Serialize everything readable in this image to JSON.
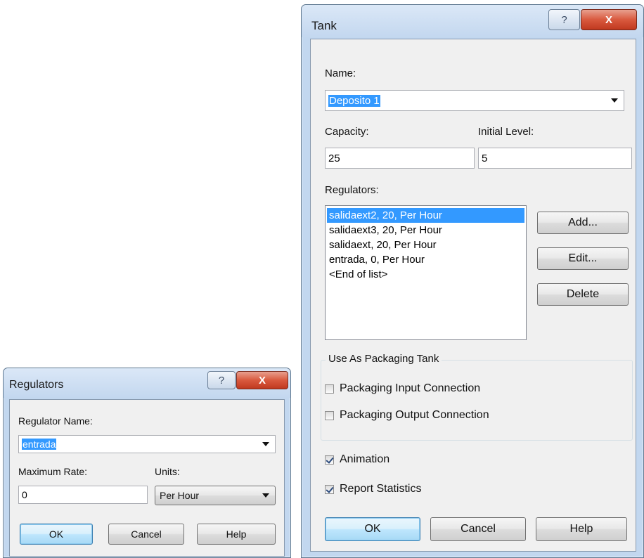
{
  "tank_dialog": {
    "title": "Tank",
    "help_glyph": "?",
    "close_glyph": "X",
    "name_label": "Name:",
    "name_value": "Deposito 1",
    "capacity_label": "Capacity:",
    "capacity_value": "25",
    "initial_level_label": "Initial Level:",
    "initial_level_value": "5",
    "regulators_label": "Regulators:",
    "regulators": [
      "salidaext2, 20, Per Hour",
      "salidaext3, 20, Per Hour",
      "salidaext, 20, Per Hour",
      "entrada, 0, Per Hour",
      "<End of list>"
    ],
    "add_button": "Add...",
    "edit_button": "Edit...",
    "delete_button": "Delete",
    "packaging_group_label": "Use As Packaging Tank",
    "packaging_input_label": "Packaging Input Connection",
    "packaging_output_label": "Packaging Output Connection",
    "animation_label": "Animation",
    "report_statistics_label": "Report Statistics",
    "ok_button": "OK",
    "cancel_button": "Cancel",
    "help_button": "Help"
  },
  "regulators_dialog": {
    "title": "Regulators",
    "help_glyph": "?",
    "close_glyph": "X",
    "name_label": "Regulator Name:",
    "name_value": "entrada",
    "max_rate_label": "Maximum Rate:",
    "max_rate_value": "0",
    "units_label": "Units:",
    "units_value": "Per Hour",
    "ok_button": "OK",
    "cancel_button": "Cancel",
    "help_button": "Help"
  }
}
